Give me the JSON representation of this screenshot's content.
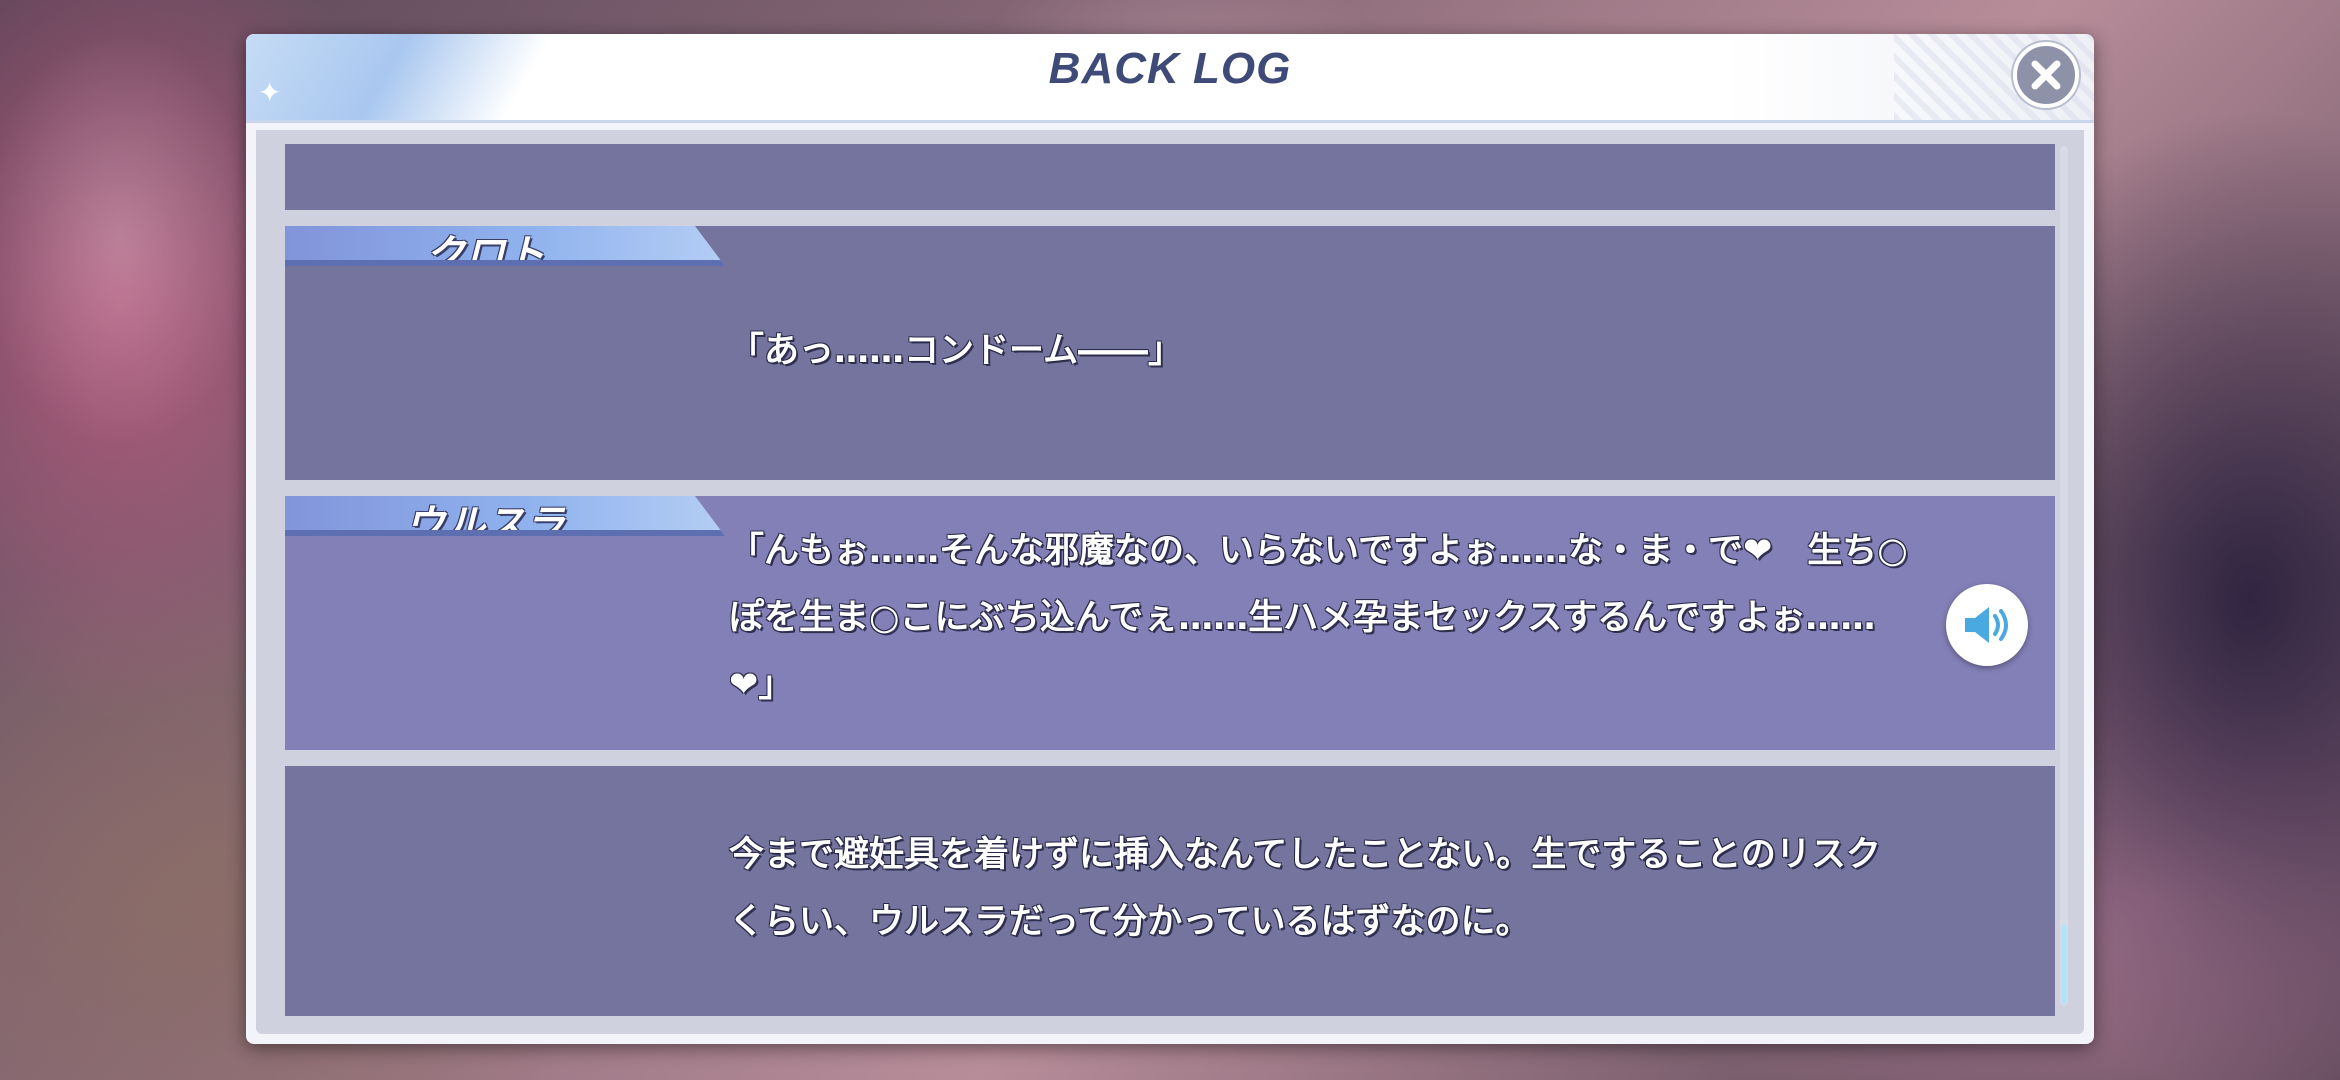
{
  "window": {
    "title": "BACK LOG"
  },
  "entries": [
    {
      "speaker": "",
      "text": ""
    },
    {
      "speaker": "クロト",
      "text": "「あっ……コンドーム――」"
    },
    {
      "speaker": "ウルスラ",
      "text": "「んもぉ……そんな邪魔なの、いらないですよぉ……な・ま・で❤　生ち○ぽを生ま○こにぶち込んでぇ……生ハメ孕まセックスするんですよぉ……❤」",
      "has_voice": true
    },
    {
      "speaker": "",
      "text": "今まで避妊具を着けずに挿入なんてしたことない。生ですることのリスクくらい、ウルスラだって分かっているはずなのに。"
    }
  ],
  "icons": {
    "close": "close-icon",
    "voice": "speaker-icon",
    "sparkle": "sparkle-icon"
  },
  "colors": {
    "title": "#3e4a78",
    "entry_bg": "#686696",
    "name_tag": "#8fb2ee",
    "scroll_thumb": "#b6e2f6"
  }
}
